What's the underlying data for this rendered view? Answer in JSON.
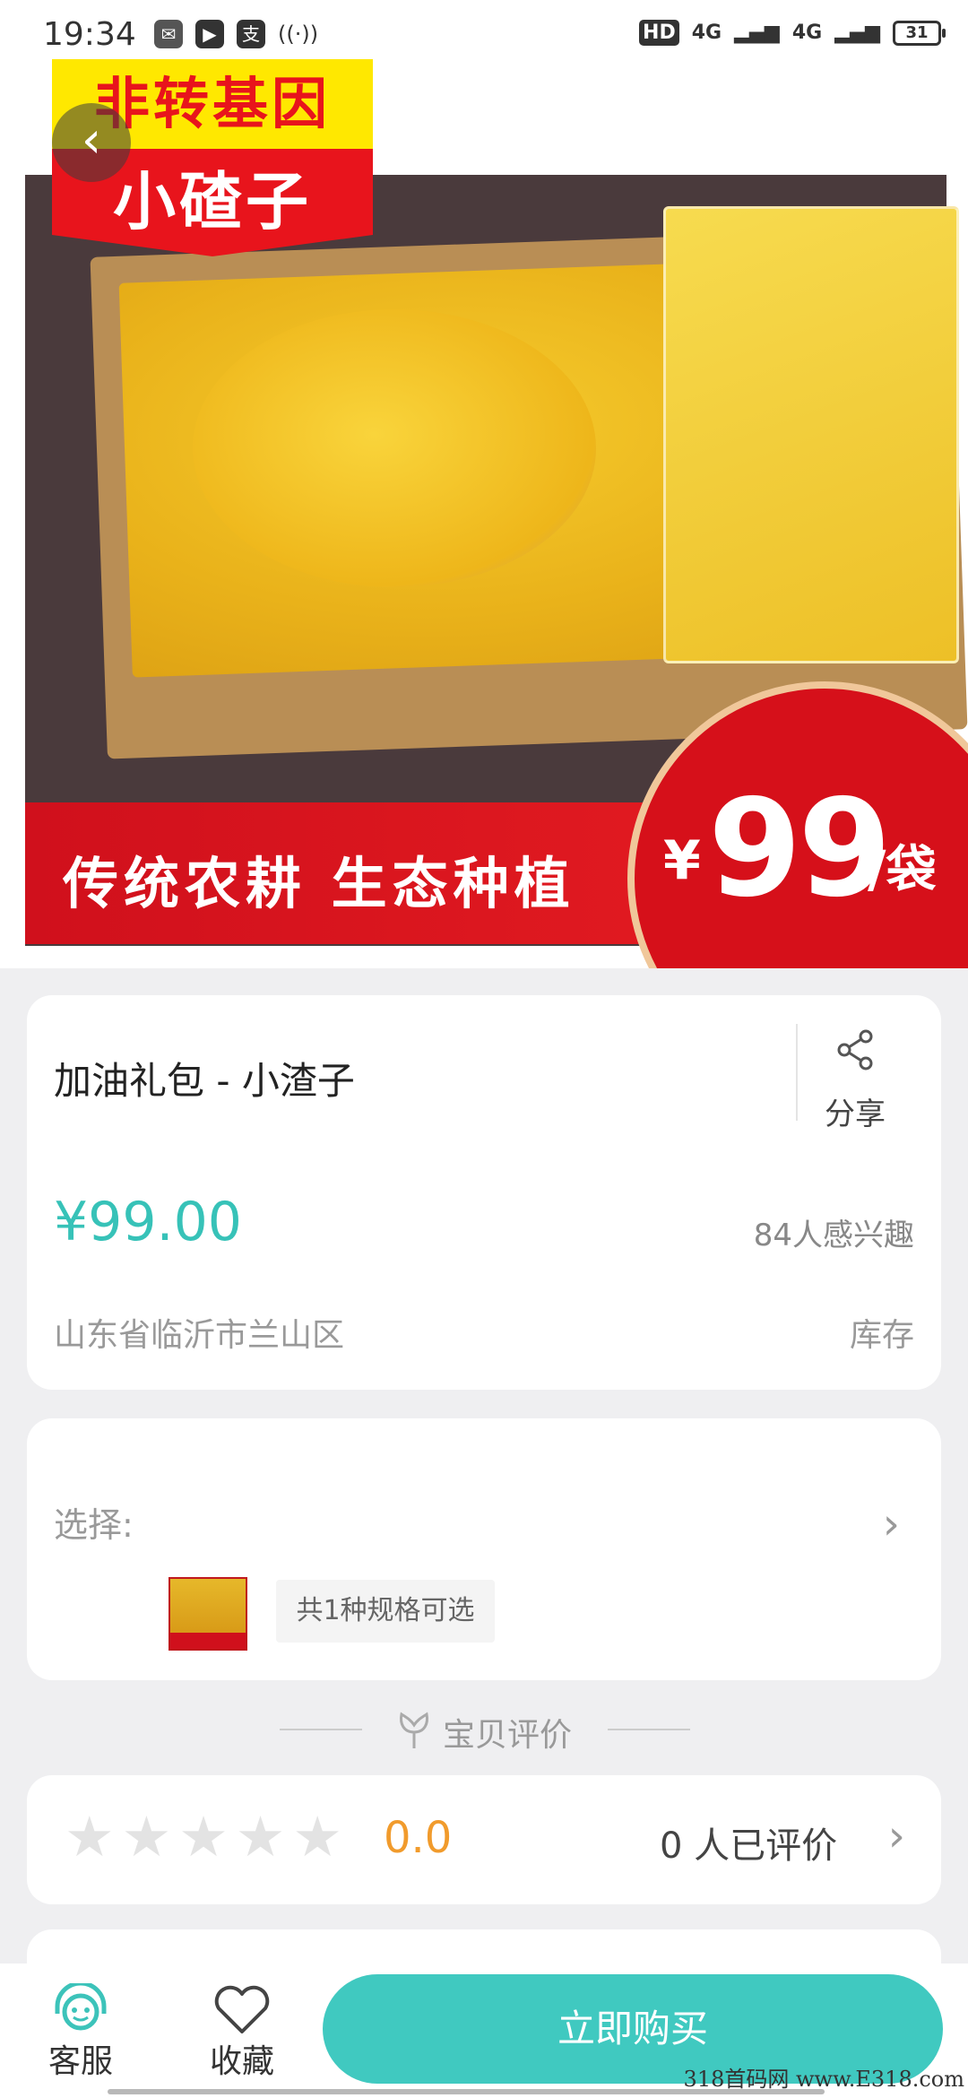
{
  "status_bar": {
    "time": "19:34",
    "right_indicators": [
      "HD",
      "4G",
      "4G"
    ],
    "battery": "31"
  },
  "hero": {
    "tag_top": "非转基因",
    "tag_bottom": "小碴子",
    "slogan": "传统农耕 生态种植",
    "price_currency": "¥",
    "price_number": "99",
    "price_unit": "/袋"
  },
  "product": {
    "title": "加油礼包 - 小渣子",
    "share_label": "分享",
    "price": "¥99.00",
    "interest": "84人感兴趣",
    "location": "山东省临沂市兰山区",
    "stock_label": "库存"
  },
  "spec": {
    "select_label": "选择:",
    "spec_chip": "共1种规格可选"
  },
  "reviews": {
    "section_title": "宝贝评价",
    "score": "0.0",
    "count_text": "0 人已评价",
    "stars_filled": 0,
    "stars_total": 5
  },
  "bottom_bar": {
    "customer_service": "客服",
    "favorite": "收藏",
    "buy_now": "立即购买"
  },
  "watermark": "318首码网 www.E318.com",
  "colors": {
    "accent": "#37c2b8",
    "buy_button": "#40c9c0",
    "score": "#f19b2c"
  }
}
